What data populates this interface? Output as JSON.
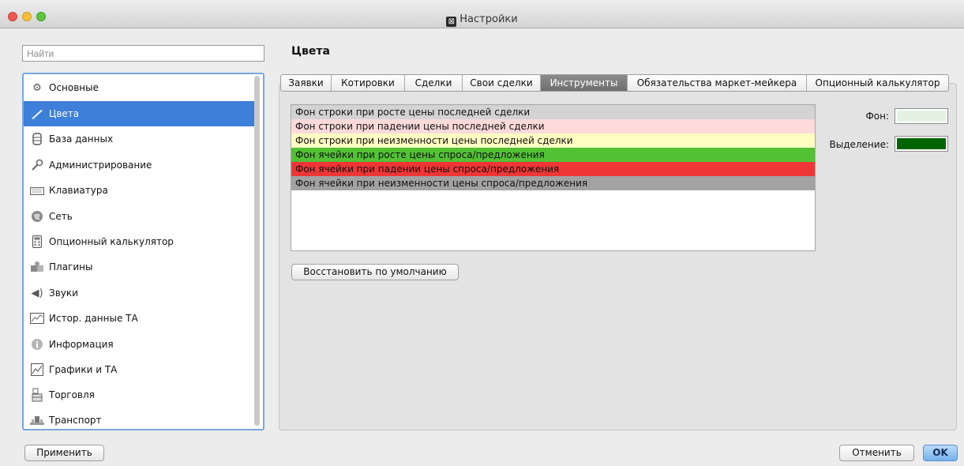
{
  "window": {
    "title": "Настройки"
  },
  "search": {
    "placeholder": "Найти"
  },
  "sidebar": {
    "items": [
      {
        "label": "Основные",
        "icon": "gear-icon"
      },
      {
        "label": "Цвета",
        "icon": "brush-icon",
        "selected": true
      },
      {
        "label": "База данных",
        "icon": "database-icon"
      },
      {
        "label": "Администрирование",
        "icon": "wrench-icon"
      },
      {
        "label": "Клавиатура",
        "icon": "keyboard-icon"
      },
      {
        "label": "Сеть",
        "icon": "globe-icon"
      },
      {
        "label": "Опционный калькулятор",
        "icon": "calculator-icon"
      },
      {
        "label": "Плагины",
        "icon": "puzzle-icon"
      },
      {
        "label": "Звуки",
        "icon": "speaker-icon"
      },
      {
        "label": "Истор. данные ТА",
        "icon": "history-chart-icon"
      },
      {
        "label": "Информация",
        "icon": "info-icon"
      },
      {
        "label": "Графики и ТА",
        "icon": "line-chart-icon"
      },
      {
        "label": "Торговля",
        "icon": "trade-icon"
      },
      {
        "label": "Транспорт",
        "icon": "transport-icon"
      }
    ]
  },
  "main": {
    "heading": "Цвета",
    "tabs": [
      {
        "label": "Заявки"
      },
      {
        "label": "Котировки"
      },
      {
        "label": "Сделки"
      },
      {
        "label": "Свои сделки"
      },
      {
        "label": "Инструменты",
        "active": true
      },
      {
        "label": "Обязательства маркет-мейкера"
      },
      {
        "label": "Опционный калькулятор"
      }
    ],
    "color_rows": [
      {
        "label": "Фон строки при росте цены последней сделки",
        "color": "#d3d3d3"
      },
      {
        "label": "Фон строки при падении цены последней сделки",
        "color": "#fddada"
      },
      {
        "label": "Фон строки при неизменности цены последней сделки",
        "color": "#fdfdc2"
      },
      {
        "label": "Фон ячейки при росте цены спроса/предложения",
        "color": "#52c234"
      },
      {
        "label": "Фон ячейки при падении цены спроса/предложения",
        "color": "#ef3636"
      },
      {
        "label": "Фон ячейки при неизменности цены спроса/предложения",
        "color": "#a2a2a2"
      }
    ],
    "reset_button": "Восстановить по умолчанию",
    "background_label": "Фон:",
    "background_color": "#e4f2e4",
    "selection_label": "Выделение:",
    "selection_color": "#006400"
  },
  "footer": {
    "apply": "Применить",
    "cancel": "Отменить",
    "ok": "OK"
  }
}
